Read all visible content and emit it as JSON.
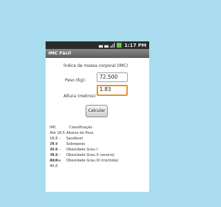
{
  "status_bar": {
    "time": "1:17 PM"
  },
  "app": {
    "title": "IMC Fácil"
  },
  "form": {
    "header": "Índice de massa corporal (IMC)",
    "weight_label": "Peso (Kg):",
    "weight_value": "72.500",
    "height_label": "Altura (metros):",
    "height_value": "1.83",
    "calculate_label": "Calcular"
  },
  "table": {
    "headers": [
      "IMC",
      "Classificação"
    ],
    "rows": [
      [
        "Até 18,5",
        "Abaixo do Peso"
      ],
      [
        "18,6 – 24,9",
        "Saudável"
      ],
      [
        "25 – 29,9",
        "Sobrepeso"
      ],
      [
        "30,0 – 34,9",
        "Obesidade Grau I"
      ],
      [
        "35,0 – 39,9",
        "Obesidade Grau II (severa)"
      ],
      [
        "Acima 40,0",
        "Obesidade Grau III (mórbida)"
      ]
    ]
  }
}
